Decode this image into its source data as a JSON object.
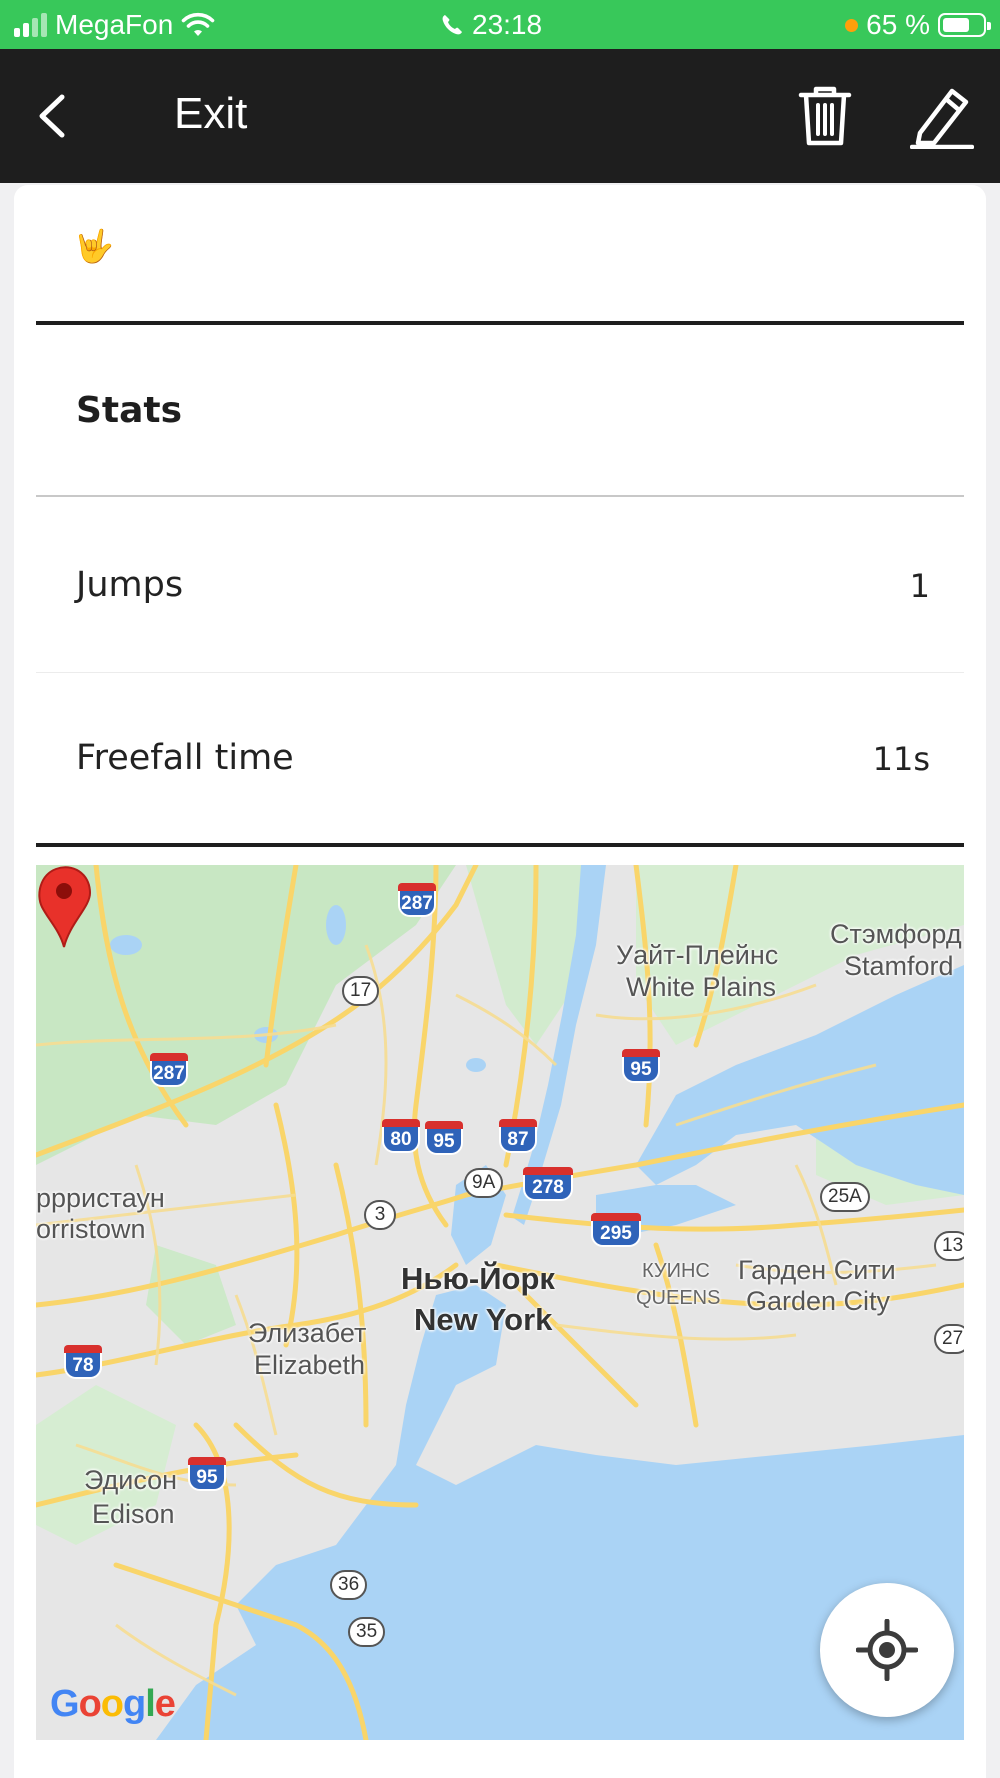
{
  "status_bar": {
    "carrier": "MegaFon",
    "time": "23:18",
    "battery": "65 %",
    "icons": [
      "signal-icon",
      "wifi-icon",
      "phone-icon",
      "orange-dot-icon",
      "battery-icon"
    ]
  },
  "nav": {
    "title": "Exit",
    "icons": [
      "back-chevron-icon",
      "trash-icon",
      "pencil-icon"
    ]
  },
  "content": {
    "emoji": "🤟",
    "section_title": "Stats",
    "stats": [
      {
        "label": "Jumps",
        "value": "1"
      },
      {
        "label": "Freefall time",
        "value": "11s"
      }
    ]
  },
  "map": {
    "labels": {
      "white_plains_ru": "Уайт-Плейнс",
      "white_plains": "White Plains",
      "stamford_ru": "Стэмфорд",
      "stamford": "Stamford",
      "morristown_ru": "ррристаун",
      "morristown": "orristown",
      "new_york_ru": "Нью-Йорк",
      "new_york": "New York",
      "queens_ru": "КУИНС",
      "queens": "QUEENS",
      "garden_city_ru": "Гарден Сити",
      "garden_city": "Garden City",
      "elizabeth_ru": "Элизабет",
      "elizabeth": "Elizabeth",
      "edison_ru": "Эдисон",
      "edison": "Edison"
    },
    "interstates": [
      "287",
      "287",
      "95",
      "80",
      "95",
      "87",
      "278",
      "295",
      "78",
      "95"
    ],
    "routes": [
      "17",
      "9A",
      "3",
      "25A",
      "13",
      "27",
      "36",
      "35"
    ],
    "logo": "Google",
    "colors": {
      "land": "#e6e6e6",
      "water": "#aad3f5",
      "park": "#c5e6c1",
      "road": "#f9d56a",
      "pin": "#e8312a"
    }
  }
}
